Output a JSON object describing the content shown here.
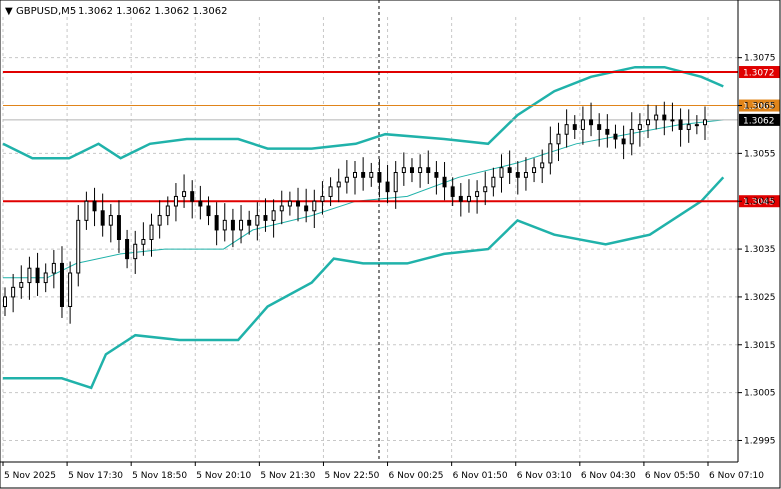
{
  "header": {
    "symbol": "GBPUSD,M5",
    "ohlc": "1.3062 1.3062 1.3062 1.3062"
  },
  "colors": {
    "background": "#ffffff",
    "grid": "#c8c8c8",
    "candle": "#000000",
    "bollinger": "#20b2aa",
    "level_red": "#e00000",
    "level_orange": "#e0841a",
    "bid_line": "#b4b4b4"
  },
  "chart_data": {
    "type": "line",
    "title": "GBPUSD,M5",
    "xlabel": "",
    "ylabel": "",
    "ylim": [
      1.29905,
      1.30835
    ],
    "grid": true,
    "y_ticks": [
      "1.3075",
      "1.3065",
      "1.3055",
      "1.3045",
      "1.3035",
      "1.3025",
      "1.3015",
      "1.3005",
      "1.2995"
    ],
    "x_tick_labels": [
      "5 Nov 2025",
      "5 Nov 17:30",
      "5 Nov 18:50",
      "5 Nov 20:10",
      "5 Nov 21:30",
      "5 Nov 22:50",
      "6 Nov 00:25",
      "6 Nov 01:50",
      "6 Nov 03:10",
      "6 Nov 04:30",
      "6 Nov 05:50",
      "6 Nov 07:10"
    ],
    "price_closes": [
      1.3025,
      1.3027,
      1.3028,
      1.3031,
      1.3028,
      1.303,
      1.3032,
      1.3023,
      1.303,
      1.3041,
      1.3045,
      1.3043,
      1.304,
      1.3042,
      1.3037,
      1.3033,
      1.3036,
      1.3037,
      1.304,
      1.3042,
      1.3044,
      1.3046,
      1.3047,
      1.3045,
      1.3044,
      1.3042,
      1.3039,
      1.3041,
      1.3039,
      1.3041,
      1.304,
      1.3042,
      1.3041,
      1.3043,
      1.3044,
      1.3045,
      1.3044,
      1.3043,
      1.3045,
      1.3046,
      1.3048,
      1.3049,
      1.305,
      1.3051,
      1.305,
      1.3051,
      1.3049,
      1.3047,
      1.3051,
      1.3052,
      1.3051,
      1.3052,
      1.3051,
      1.305,
      1.3048,
      1.3046,
      1.3045,
      1.3046,
      1.3047,
      1.3048,
      1.305,
      1.3052,
      1.3051,
      1.305,
      1.3051,
      1.3052,
      1.3053,
      1.3057,
      1.3059,
      1.3061,
      1.306,
      1.3062,
      1.3061,
      1.306,
      1.3059,
      1.3058,
      1.3057,
      1.306,
      1.3061,
      1.3062,
      1.3063,
      1.3062,
      1.3062,
      1.306,
      1.3061,
      1.3061,
      1.3062
    ],
    "moving_average": [
      {
        "t": 0,
        "y": 1.3029
      },
      {
        "t": 0.06,
        "y": 1.3029
      },
      {
        "t": 0.1,
        "y": 1.3032
      },
      {
        "t": 0.16,
        "y": 1.3034
      },
      {
        "t": 0.22,
        "y": 1.3035
      },
      {
        "t": 0.3,
        "y": 1.3035
      },
      {
        "t": 0.34,
        "y": 1.3039
      },
      {
        "t": 0.42,
        "y": 1.3042
      },
      {
        "t": 0.48,
        "y": 1.3045
      },
      {
        "t": 0.55,
        "y": 1.3046
      },
      {
        "t": 0.62,
        "y": 1.305
      },
      {
        "t": 0.7,
        "y": 1.3053
      },
      {
        "t": 0.78,
        "y": 1.3057
      },
      {
        "t": 0.85,
        "y": 1.3059
      },
      {
        "t": 0.92,
        "y": 1.3061
      },
      {
        "t": 0.98,
        "y": 1.3062
      }
    ],
    "bollinger_upper": [
      {
        "t": 0,
        "y": 1.3057
      },
      {
        "t": 0.04,
        "y": 1.3054
      },
      {
        "t": 0.09,
        "y": 1.3054
      },
      {
        "t": 0.13,
        "y": 1.3057
      },
      {
        "t": 0.16,
        "y": 1.3054
      },
      {
        "t": 0.2,
        "y": 1.3057
      },
      {
        "t": 0.25,
        "y": 1.3058
      },
      {
        "t": 0.32,
        "y": 1.3058
      },
      {
        "t": 0.36,
        "y": 1.3056
      },
      {
        "t": 0.42,
        "y": 1.3056
      },
      {
        "t": 0.48,
        "y": 1.3057
      },
      {
        "t": 0.52,
        "y": 1.3059
      },
      {
        "t": 0.6,
        "y": 1.3058
      },
      {
        "t": 0.66,
        "y": 1.3057
      },
      {
        "t": 0.7,
        "y": 1.3063
      },
      {
        "t": 0.75,
        "y": 1.3068
      },
      {
        "t": 0.8,
        "y": 1.3071
      },
      {
        "t": 0.86,
        "y": 1.3073
      },
      {
        "t": 0.9,
        "y": 1.3073
      },
      {
        "t": 0.95,
        "y": 1.3071
      },
      {
        "t": 0.98,
        "y": 1.3069
      }
    ],
    "bollinger_lower": [
      {
        "t": 0,
        "y": 1.3008
      },
      {
        "t": 0.08,
        "y": 1.3008
      },
      {
        "t": 0.12,
        "y": 1.3006
      },
      {
        "t": 0.14,
        "y": 1.3013
      },
      {
        "t": 0.18,
        "y": 1.3017
      },
      {
        "t": 0.24,
        "y": 1.3016
      },
      {
        "t": 0.32,
        "y": 1.3016
      },
      {
        "t": 0.36,
        "y": 1.3023
      },
      {
        "t": 0.42,
        "y": 1.3028
      },
      {
        "t": 0.45,
        "y": 1.3033
      },
      {
        "t": 0.49,
        "y": 1.3032
      },
      {
        "t": 0.55,
        "y": 1.3032
      },
      {
        "t": 0.6,
        "y": 1.3034
      },
      {
        "t": 0.66,
        "y": 1.3035
      },
      {
        "t": 0.7,
        "y": 1.3041
      },
      {
        "t": 0.75,
        "y": 1.3038
      },
      {
        "t": 0.82,
        "y": 1.3036
      },
      {
        "t": 0.88,
        "y": 1.3038
      },
      {
        "t": 0.95,
        "y": 1.3045
      },
      {
        "t": 0.98,
        "y": 1.305
      }
    ],
    "levels": [
      {
        "label": "1.3072",
        "value": 1.3072,
        "color": "#e00000"
      },
      {
        "label": "1.3065",
        "value": 1.3065,
        "color": "#e0841a"
      },
      {
        "label": "1.3062",
        "value": 1.3062,
        "color": "#000000"
      },
      {
        "label": "1.3045",
        "value": 1.3045,
        "color": "#e00000"
      }
    ]
  }
}
